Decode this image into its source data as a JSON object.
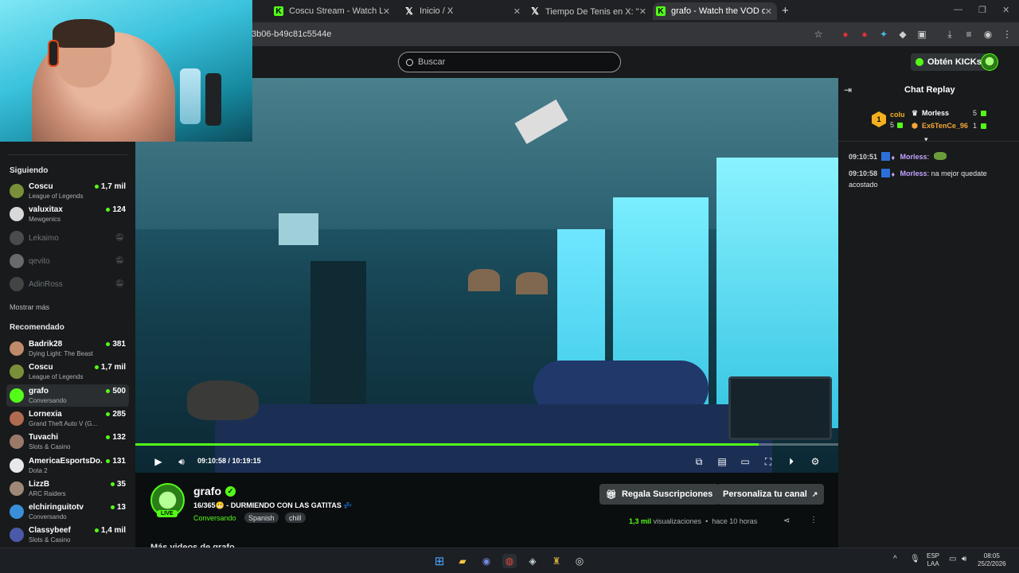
{
  "browser": {
    "tabs": [
      {
        "title": "Coscu Stream - Watch Live on K",
        "icon": "kick-icon"
      },
      {
        "title": "Inicio / X",
        "icon": "x-icon"
      },
      {
        "title": "Tiempo De Tenis en X: \"😱 EL E",
        "icon": "x-icon"
      },
      {
        "title": "grafo - Watch the VOD on Kick",
        "icon": "kick-icon",
        "active": true
      }
    ],
    "url": "3b06-b49c81c5544e"
  },
  "header": {
    "search_placeholder": "Buscar",
    "kicks_button": "Obtén KICKs"
  },
  "sidebar": {
    "following_heading": "Siguiendo",
    "following": [
      {
        "name": "Coscu",
        "category": "League of Legends",
        "viewers": "1,7 mil",
        "live": true,
        "avatar_color": "#7a8f3a"
      },
      {
        "name": "valuxitax",
        "category": "Mewgenics",
        "viewers": "124",
        "live": true,
        "avatar_color": "#d8d8d8"
      },
      {
        "name": "Lekaimo",
        "live": false,
        "avatar_color": "#888888"
      },
      {
        "name": "qevito",
        "live": false,
        "avatar_color": "#cccccc"
      },
      {
        "name": "AdinRoss",
        "live": false,
        "avatar_color": "#777777"
      }
    ],
    "show_more": "Mostrar más",
    "recommended_heading": "Recomendado",
    "recommended": [
      {
        "name": "Badrik28",
        "category": "Dying Light: The Beast",
        "viewers": "381",
        "avatar_color": "#c08a6a"
      },
      {
        "name": "Coscu",
        "category": "League of Legends",
        "viewers": "1,7 mil",
        "avatar_color": "#7a8f3a"
      },
      {
        "name": "grafo",
        "category": "Conversando",
        "viewers": "500",
        "active": true,
        "avatar_color": "#53fc18"
      },
      {
        "name": "Lornexia",
        "category": "Grand Theft Auto V (G...",
        "viewers": "285",
        "avatar_color": "#b06a50"
      },
      {
        "name": "Tuvachi",
        "category": "Slots & Casino",
        "viewers": "132",
        "avatar_color": "#9b7a6a"
      },
      {
        "name": "AmericaEsportsDo...",
        "category": "Dota 2",
        "viewers": "131",
        "avatar_color": "#e8e8e8"
      },
      {
        "name": "LizzB",
        "category": "ARC Raiders",
        "viewers": "35",
        "avatar_color": "#a08878"
      },
      {
        "name": "elchiringuitotv",
        "category": "Conversando",
        "viewers": "13",
        "avatar_color": "#3a8fd8"
      },
      {
        "name": "Classybeef",
        "category": "Slots & Casino",
        "viewers": "1,4 mil",
        "avatar_color": "#4a5aa8"
      }
    ]
  },
  "player": {
    "current_time": "09:10:58",
    "duration": "10:19:15",
    "progress_fraction": 0.887
  },
  "channel": {
    "name": "grafo",
    "live_badge": "LIVE",
    "title": "16/365😬 - DURMIENDO CON LAS GATITAS 💤",
    "category": "Conversando",
    "tags": [
      "Spanish",
      "chill"
    ],
    "gift_button": "Regala Suscripciones",
    "customize_button": "Personaliza tu canal",
    "views_count": "1,3 mil",
    "views_label": "visualizaciones",
    "time_ago": "hace 10 horas",
    "more_videos": "Más videos de grafo"
  },
  "chat": {
    "title": "Chat Replay",
    "leaderboard": {
      "rank": "1",
      "first": {
        "name": "colu",
        "count": "5"
      },
      "entries": [
        {
          "name": "Morless",
          "count": "5"
        },
        {
          "name": "Ex6TenCe_96",
          "count": "1"
        }
      ]
    },
    "messages": [
      {
        "time": "09:10:51",
        "user": "Morless",
        "text": ""
      },
      {
        "time": "09:10:58",
        "user": "Morless",
        "text": "na mejor quedate acostado"
      }
    ]
  },
  "taskbar": {
    "lang": "ESP",
    "layout": "LAA",
    "time": "08:05",
    "date": "25/2/2026"
  }
}
